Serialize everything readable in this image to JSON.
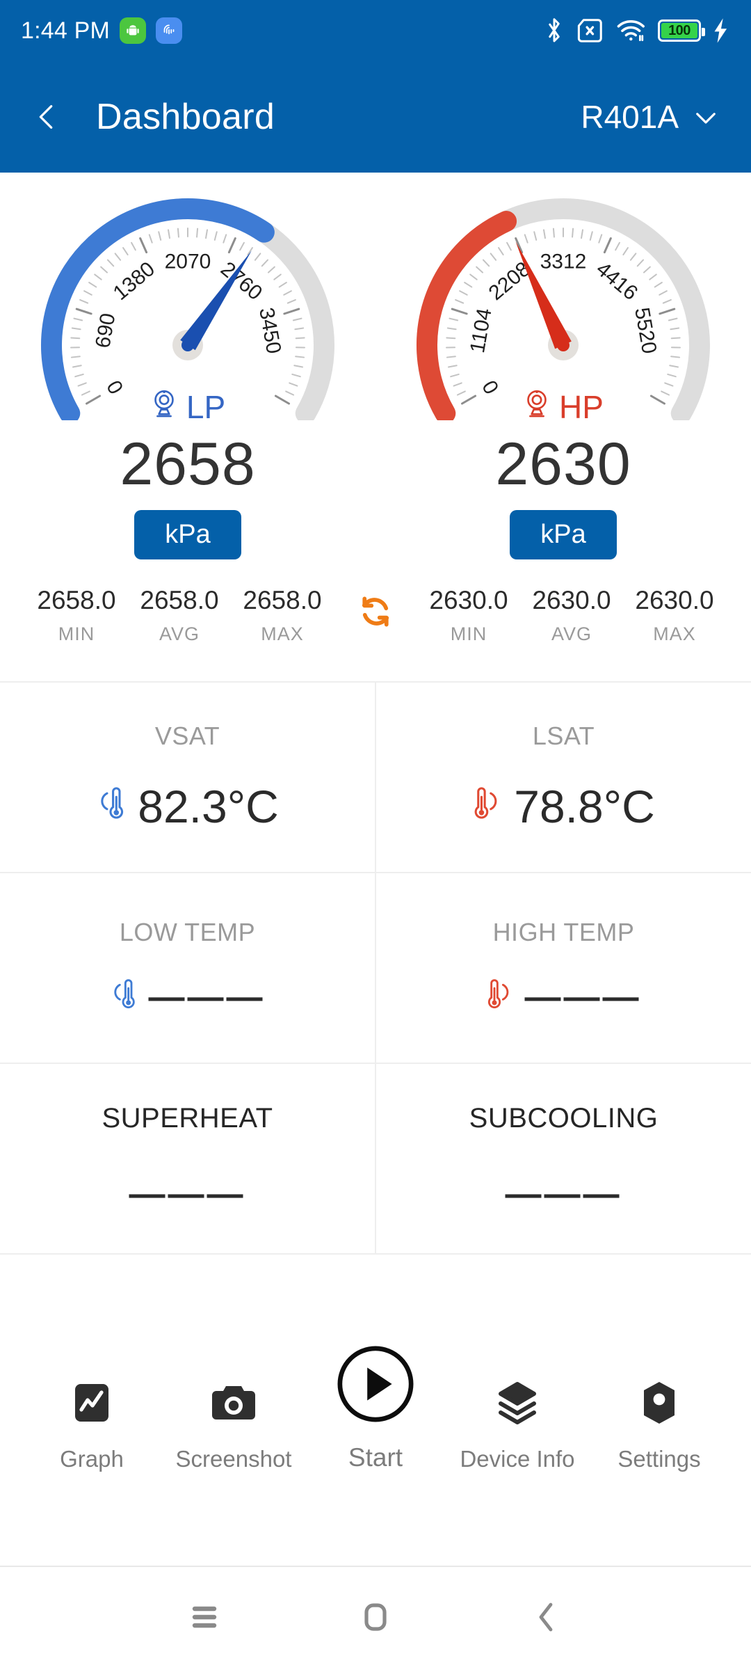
{
  "status_bar": {
    "time": "1:44 PM",
    "app_icons": [
      {
        "name": "android-robot-icon",
        "glyph": "ᾑ6"
      },
      {
        "name": "fingerprint-icon",
        "glyph": ""
      }
    ],
    "icons": [
      "bluetooth-icon",
      "no-sim-icon",
      "wifi-icon",
      "battery-icon",
      "charging-bolt-icon"
    ],
    "battery_level": "100"
  },
  "app_bar": {
    "back_label": "Back",
    "title": "Dashboard",
    "refrigerant": "R401A"
  },
  "gauges": [
    {
      "id": "lp",
      "label": "LP",
      "accent": "#3e7bd4",
      "track": "#dddddd",
      "needle_color": "#1a4fb0",
      "value": "2658",
      "unit": "kPa",
      "min_value": 0,
      "max_value": 4140,
      "current": 2658,
      "ticks": [
        "0",
        "690",
        "1380",
        "2070",
        "2760",
        "3450"
      ],
      "stats": [
        {
          "key": "MIN",
          "value": "2658.0"
        },
        {
          "key": "AVG",
          "value": "2658.0"
        },
        {
          "key": "MAX",
          "value": "2658.0"
        }
      ]
    },
    {
      "id": "hp",
      "label": "HP",
      "accent": "#de4a35",
      "track": "#dddddd",
      "needle_color": "#d62d1a",
      "value": "2630",
      "unit": "kPa",
      "min_value": 0,
      "max_value": 6624,
      "current": 2630,
      "ticks": [
        "0",
        "1104",
        "2208",
        "3312",
        "4416",
        "5520"
      ],
      "stats": [
        {
          "key": "MIN",
          "value": "2630.0"
        },
        {
          "key": "AVG",
          "value": "2630.0"
        },
        {
          "key": "MAX",
          "value": "2630.0"
        }
      ]
    }
  ],
  "refresh_icon_color": "#ef7c16",
  "metrics": [
    {
      "name": "vsat",
      "label": "VSAT",
      "value": "82.3°C",
      "icon": "thermometer-cold-icon",
      "icon_color": "#3e7bd4",
      "label_style": "muted"
    },
    {
      "name": "lsat",
      "label": "LSAT",
      "value": "78.8°C",
      "icon": "thermometer-hot-icon",
      "icon_color": "#e04a33",
      "label_style": "muted"
    },
    {
      "name": "low-temp",
      "label": "LOW TEMP",
      "value": "———",
      "icon": "thermometer-cold-icon",
      "icon_color": "#3e7bd4",
      "label_style": "muted"
    },
    {
      "name": "high-temp",
      "label": "HIGH TEMP",
      "value": "———",
      "icon": "thermometer-hot-icon",
      "icon_color": "#e04a33",
      "label_style": "muted"
    },
    {
      "name": "superheat",
      "label": "SUPERHEAT",
      "value": "———",
      "icon": null,
      "icon_color": null,
      "label_style": "dark"
    },
    {
      "name": "subcooling",
      "label": "SUBCOOLING",
      "value": "———",
      "icon": null,
      "icon_color": null,
      "label_style": "dark"
    }
  ],
  "toolbar": [
    {
      "name": "graph",
      "label": "Graph",
      "icon": "chart-line-icon"
    },
    {
      "name": "screenshot",
      "label": "Screenshot",
      "icon": "camera-icon"
    },
    {
      "name": "start",
      "label": "Start",
      "icon": "play-circle-icon"
    },
    {
      "name": "device-info",
      "label": "Device Info",
      "icon": "layers-icon"
    },
    {
      "name": "settings",
      "label": "Settings",
      "icon": "hexagon-gear-icon"
    }
  ],
  "nav_bar": [
    {
      "name": "recents-button",
      "icon": "hamburger-icon"
    },
    {
      "name": "home-button",
      "icon": "home-square-icon"
    },
    {
      "name": "back-button",
      "icon": "chevron-left-icon"
    }
  ]
}
